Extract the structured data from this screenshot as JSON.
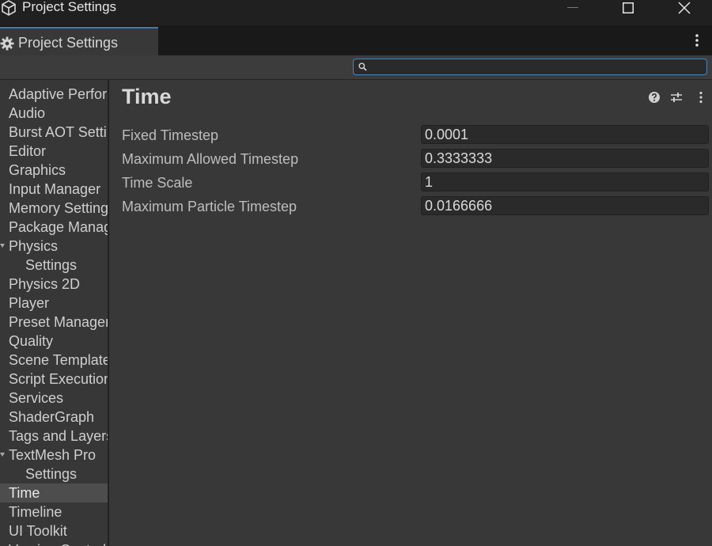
{
  "window": {
    "title": "Project Settings",
    "icon": "unity-logo-icon"
  },
  "tab": {
    "label": "Project Settings",
    "icon": "gear-icon"
  },
  "search": {
    "value": "",
    "placeholder": ""
  },
  "sidebar": {
    "items": [
      {
        "label": "Adaptive Performance",
        "child": false
      },
      {
        "label": "Audio",
        "child": false
      },
      {
        "label": "Burst AOT Settings",
        "child": false
      },
      {
        "label": "Editor",
        "child": false
      },
      {
        "label": "Graphics",
        "child": false
      },
      {
        "label": "Input Manager",
        "child": false
      },
      {
        "label": "Memory Settings",
        "child": false
      },
      {
        "label": "Package Manager",
        "child": false
      },
      {
        "label": "Physics",
        "child": false,
        "foldout": true
      },
      {
        "label": "Settings",
        "child": true
      },
      {
        "label": "Physics 2D",
        "child": false
      },
      {
        "label": "Player",
        "child": false
      },
      {
        "label": "Preset Manager",
        "child": false
      },
      {
        "label": "Quality",
        "child": false
      },
      {
        "label": "Scene Template",
        "child": false
      },
      {
        "label": "Script Execution Order",
        "child": false
      },
      {
        "label": "Services",
        "child": false
      },
      {
        "label": "ShaderGraph",
        "child": false
      },
      {
        "label": "Tags and Layers",
        "child": false
      },
      {
        "label": "TextMesh Pro",
        "child": false,
        "foldout": true
      },
      {
        "label": "Settings",
        "child": true
      },
      {
        "label": "Time",
        "child": false,
        "selected": true
      },
      {
        "label": "Timeline",
        "child": false
      },
      {
        "label": "UI Toolkit",
        "child": false
      },
      {
        "label": "Version Control",
        "child": false
      }
    ]
  },
  "main": {
    "title": "Time",
    "fields": [
      {
        "label": "Fixed Timestep",
        "value": "0.0001"
      },
      {
        "label": "Maximum Allowed Timestep",
        "value": "0.3333333"
      },
      {
        "label": "Time Scale",
        "value": "1"
      },
      {
        "label": "Maximum Particle Timestep",
        "value": "0.0166666"
      }
    ]
  },
  "colors": {
    "background": "#383838",
    "accent": "#3a79bb",
    "selected": "#4d4d4d"
  }
}
